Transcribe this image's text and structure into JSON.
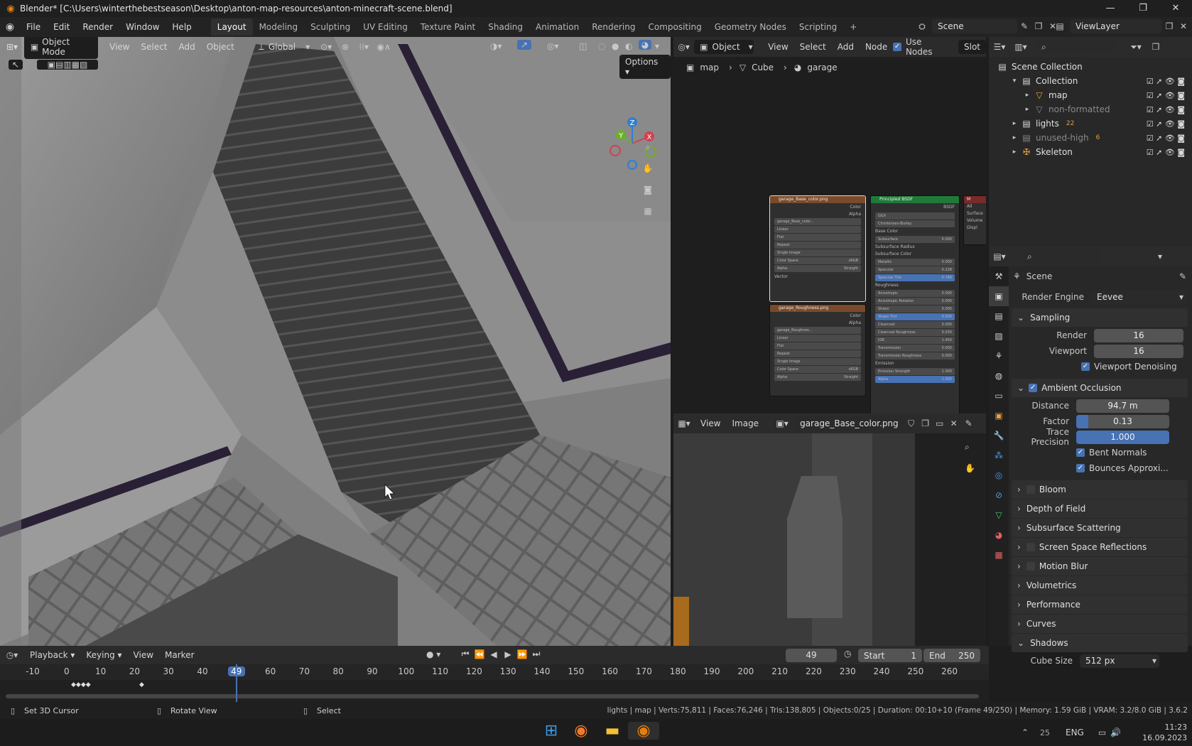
{
  "window": {
    "title": "Blender* [C:\\Users\\winterthebestseason\\Desktop\\anton-map-resources\\anton-minecraft-scene.blend]",
    "controls": [
      "—",
      "❐",
      "✕"
    ]
  },
  "menu": [
    "File",
    "Edit",
    "Render",
    "Window",
    "Help"
  ],
  "workspaces": [
    "Layout",
    "Modeling",
    "Sculpting",
    "UV Editing",
    "Texture Paint",
    "Shading",
    "Animation",
    "Rendering",
    "Compositing",
    "Geometry Nodes",
    "Scripting"
  ],
  "workspaces_add": "+",
  "scene_selector": "Scene",
  "viewlayer_selector": "ViewLayer",
  "viewport": {
    "mode": "Object Mode",
    "menus": [
      "View",
      "Select",
      "Add",
      "Object"
    ],
    "transform_orientation": "Global",
    "options_label": "Options",
    "gizmo_labels": {
      "x": "X",
      "y": "Y",
      "z": "Z"
    }
  },
  "node_editor": {
    "type_menu": "Object",
    "menus": [
      "View",
      "Select",
      "Add",
      "Node"
    ],
    "use_nodes_label": "Use Nodes",
    "slot_label": "Slot",
    "breadcrumb": [
      "map",
      "Cube",
      "garage"
    ],
    "base_color_node": {
      "title": "garage_Base_color.png",
      "outputs": [
        "Color",
        "Alpha"
      ],
      "image_name": "garage_Base_color...",
      "options": [
        "Linear",
        "Flat",
        "Repeat",
        "Single Image"
      ],
      "colorspace_label": "Color Space",
      "colorspace": "sRGB",
      "alpha_label": "Alpha",
      "alpha": "Straight",
      "vector": "Vector"
    },
    "roughness_node": {
      "title": "garage_Roughness.png",
      "outputs": [
        "Color",
        "Alpha"
      ],
      "image_name": "garage_Roughnes...",
      "options": [
        "Linear",
        "Flat",
        "Repeat",
        "Single Image"
      ],
      "colorspace_label": "Color Space",
      "colorspace": "sRGB",
      "alpha_label": "Alpha",
      "alpha": "Straight"
    },
    "bsdf_node": {
      "title": "Principled BSDF",
      "output": "BSDF",
      "dropdowns": [
        "GGX",
        "Christensen-Burley"
      ],
      "rows": [
        {
          "label": "Base Color",
          "value": ""
        },
        {
          "label": "Subsurface",
          "value": "0.000"
        },
        {
          "label": "Subsurface Radius",
          "value": ""
        },
        {
          "label": "Subsurface Color",
          "value": ""
        },
        {
          "label": "Metallic",
          "value": "0.000"
        },
        {
          "label": "Specular",
          "value": "0.228"
        },
        {
          "label": "Specular Tint",
          "value": "0.786"
        },
        {
          "label": "Roughness",
          "value": ""
        },
        {
          "label": "Anisotropic",
          "value": "0.000"
        },
        {
          "label": "Anisotropic Rotation",
          "value": "0.000"
        },
        {
          "label": "Sheen",
          "value": "0.000"
        },
        {
          "label": "Sheen Tint",
          "value": "0.500"
        },
        {
          "label": "Clearcoat",
          "value": "0.000"
        },
        {
          "label": "Clearcoat Roughness",
          "value": "0.030"
        },
        {
          "label": "IOR",
          "value": "1.450"
        },
        {
          "label": "Transmission",
          "value": "0.000"
        },
        {
          "label": "Transmission Roughness",
          "value": "0.000"
        },
        {
          "label": "Emission",
          "value": ""
        },
        {
          "label": "Emission Strength",
          "value": "1.000"
        },
        {
          "label": "Alpha",
          "value": "1.000"
        }
      ]
    },
    "output_node": {
      "title": "M",
      "inputs": [
        "All",
        "Surface",
        "Volume",
        "Displ"
      ]
    }
  },
  "image_editor": {
    "menus": [
      "View",
      "Image"
    ],
    "image_name": "garage_Base_color.png"
  },
  "outliner": {
    "rows": [
      {
        "label": "Scene Collection",
        "indent": 0,
        "dim": false
      },
      {
        "label": "Collection",
        "indent": 1,
        "dim": false
      },
      {
        "label": "map",
        "indent": 2,
        "dim": false
      },
      {
        "label": "non-formatted",
        "indent": 2,
        "dim": true
      },
      {
        "label": "lights",
        "indent": 1,
        "dim": false,
        "badge": "22"
      },
      {
        "label": "unused-high",
        "indent": 1,
        "dim": true,
        "badge": "6"
      },
      {
        "label": "Skeleton",
        "indent": 1,
        "dim": false
      }
    ]
  },
  "properties": {
    "context": "Scene",
    "render_engine_label": "Render Engine",
    "render_engine": "Eevee",
    "sampling": {
      "title": "Sampling",
      "render_label": "Render",
      "render": "16",
      "viewport_label": "Viewport",
      "viewport": "16",
      "denoise": "Viewport Denoising"
    },
    "ao": {
      "title": "Ambient Occlusion",
      "distance_label": "Distance",
      "distance": "94.7 m",
      "factor_label": "Factor",
      "factor": "0.13",
      "factor_fraction": 0.13,
      "trace_label": "Trace Precision",
      "trace": "1.000",
      "bent": "Bent Normals",
      "bounces": "Bounces Approxi..."
    },
    "panels": [
      "Bloom",
      "Depth of Field",
      "Subsurface Scattering",
      "Screen Space Reflections",
      "Motion Blur",
      "Volumetrics",
      "Performance",
      "Curves"
    ],
    "shadows": {
      "title": "Shadows",
      "cube_label": "Cube Size",
      "cube": "512 px"
    }
  },
  "timeline": {
    "menus": [
      "Playback",
      "Keying",
      "View",
      "Marker"
    ],
    "current_frame": "49",
    "start_label": "Start",
    "start": "1",
    "end_label": "End",
    "end": "250",
    "ticks": [
      "-10",
      "0",
      "10",
      "20",
      "30",
      "40",
      "49",
      "60",
      "70",
      "80",
      "90",
      "100",
      "110",
      "120",
      "130",
      "140",
      "150",
      "160",
      "170",
      "180",
      "190",
      "200",
      "210",
      "220",
      "230",
      "240",
      "250",
      "260"
    ]
  },
  "status": {
    "hint1": "Set 3D Cursor",
    "hint2": "Rotate View",
    "hint3": "Select",
    "stats": "lights | map | Verts:75,811 | Faces:76,246 | Tris:138,805 | Objects:0/25 | Duration: 00:10+10 (Frame 49/250) | Memory: 1.59 GiB | VRAM: 3.2/8.0 GiB | 3.6.2"
  },
  "taskbar": {
    "tray_num": "25",
    "lang": "ENG",
    "time": "11:23",
    "date": "16.09.2023"
  },
  "colors": {
    "accent": "#4772b3",
    "header": "#2b2b2b",
    "panel": "#282828",
    "frame": "#4772b3"
  }
}
